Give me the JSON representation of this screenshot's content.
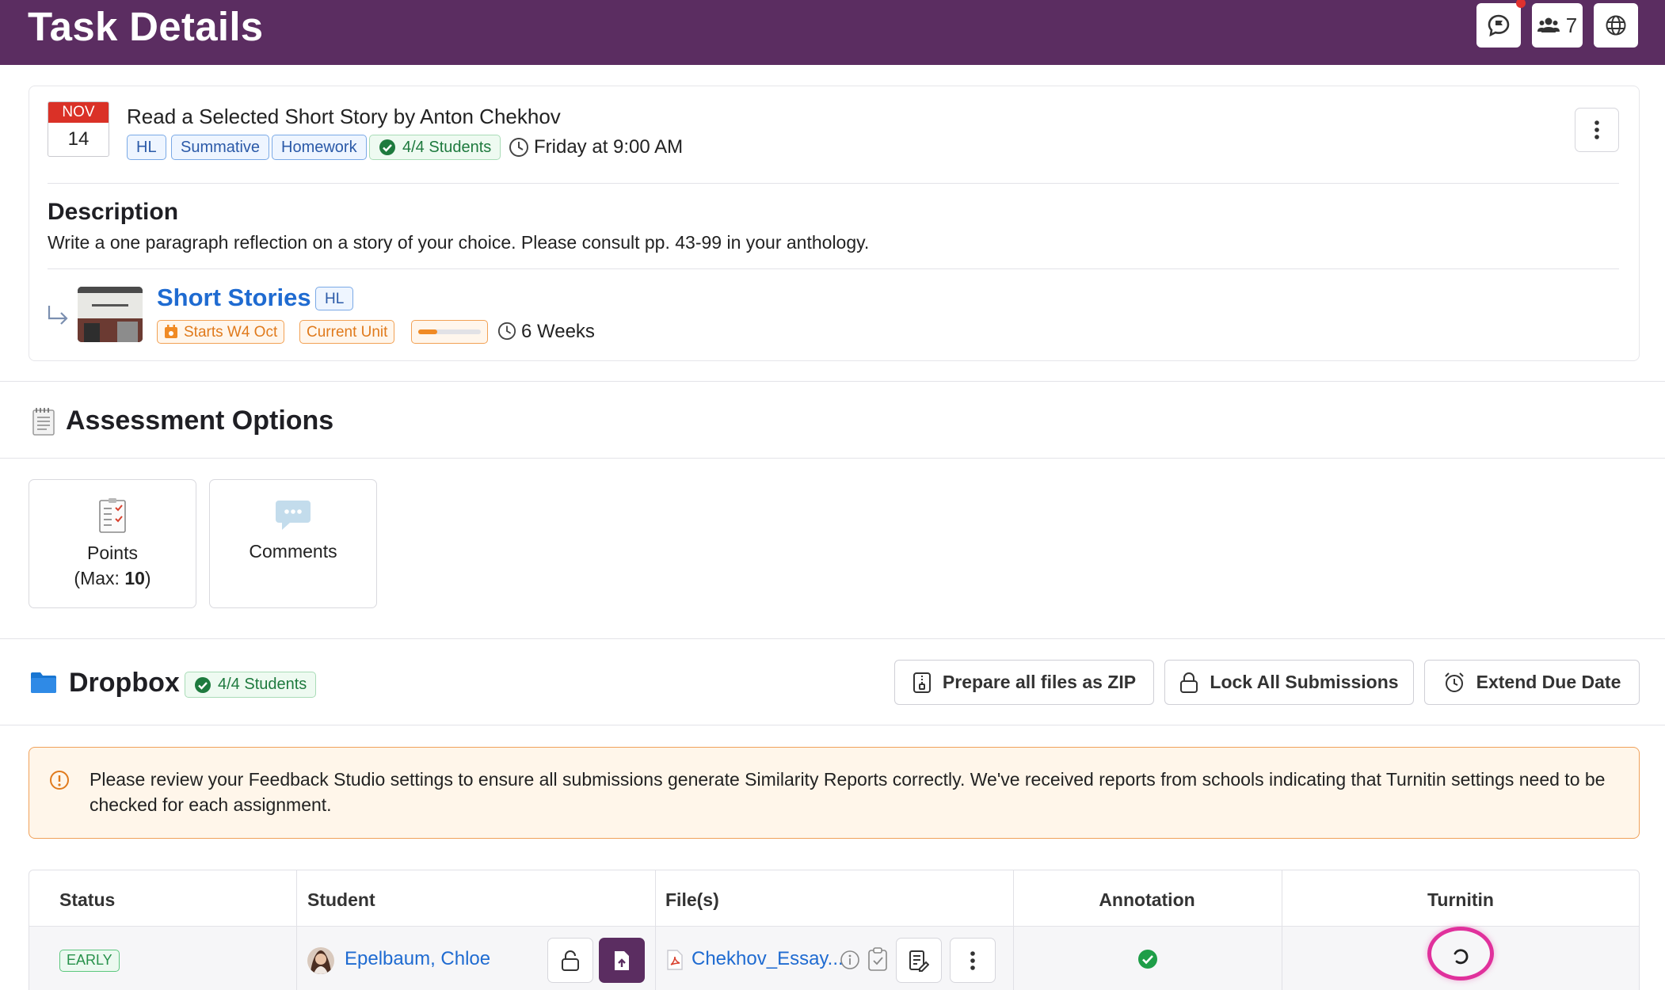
{
  "header": {
    "title": "Task Details",
    "people_count": "7"
  },
  "task": {
    "month": "NOV",
    "day": "14",
    "title": "Read a Selected Short Story by Anton Chekhov",
    "tags": [
      "HL",
      "Summative",
      "Homework"
    ],
    "students_badge": "4/4 Students",
    "due": "Friday at 9:00 AM",
    "description_heading": "Description",
    "description": "Write a one paragraph reflection on a story of your choice. Please consult pp. 43-99 in your anthology."
  },
  "unit": {
    "title": "Short Stories",
    "level": "HL",
    "starts": "Starts W4 Oct",
    "current": "Current Unit",
    "progress": 0.3,
    "duration": "6 Weeks"
  },
  "assessment": {
    "heading": "Assessment Options",
    "points_label": "Points",
    "points_max_prefix": "(Max: ",
    "points_max_value": "10",
    "points_max_suffix": ")",
    "comments_label": "Comments"
  },
  "dropbox": {
    "heading": "Dropbox",
    "students_badge": "4/4 Students",
    "prepare_zip": "Prepare all files as ZIP",
    "lock_all": "Lock All Submissions",
    "extend_due": "Extend Due Date"
  },
  "warning": {
    "text": "Please review your Feedback Studio settings to ensure all submissions generate Similarity Reports correctly. We've received reports from schools indicating that Turnitin settings need to be checked for each assignment."
  },
  "table": {
    "columns": [
      "Status",
      "Student",
      "File(s)",
      "Annotation",
      "Turnitin"
    ],
    "rows": [
      {
        "status": "EARLY",
        "student": "Epelbaum, Chloe",
        "file": "Chekhov_Essay..."
      }
    ]
  },
  "colors": {
    "brand": "#5b2d61",
    "link": "#1f6bd1",
    "warning_border": "#f0a15a",
    "success": "#1e9e48",
    "highlight": "#e0319c"
  }
}
